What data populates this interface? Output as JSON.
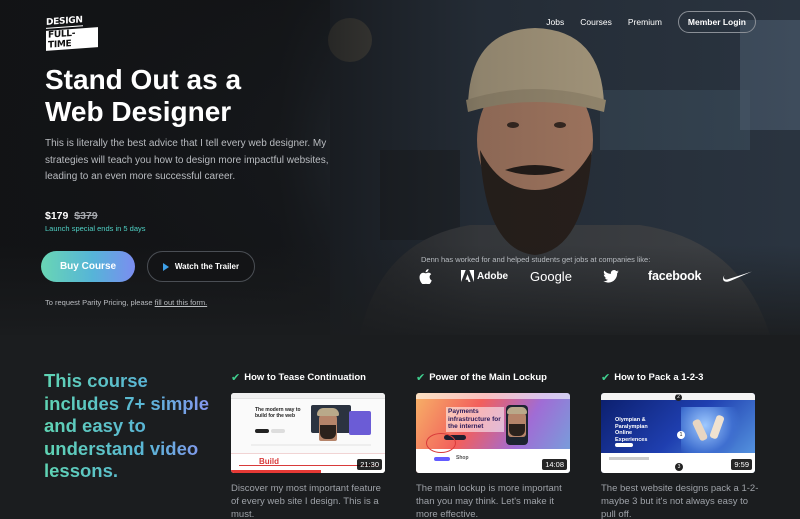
{
  "brand": {
    "logo_line1": "DESIGN",
    "logo_line2": "FULL-TIME"
  },
  "nav": {
    "jobs": "Jobs",
    "courses": "Courses",
    "premium": "Premium",
    "login": "Member Login"
  },
  "hero": {
    "title": "Stand Out as a Web Designer",
    "lead": "This is literally the best advice that I tell every web designer. My strategies will teach you how to design more impactful websites, leading to an even more successful career.",
    "price": "$179",
    "old_price": "$379",
    "special": "Launch special ends in 5 days",
    "buy_label": "Buy Course",
    "trailer_label": "Watch the Trailer",
    "parity_prefix": "To request Parity Pricing, please ",
    "parity_link": "fill out this form."
  },
  "companies": {
    "intro": "Denn has worked for and helped students get jobs at companies like:",
    "logos": [
      "apple-icon",
      "Adobe",
      "Google",
      "twitter-icon",
      "facebook",
      "nike-icon"
    ]
  },
  "course_intro": "This course includes 7+ simple and easy to understand video lessons.",
  "lessons": [
    {
      "title": "How to Tease Continuation",
      "duration": "21:30",
      "description": "Discover my most important feature of every web site I design. This is a must.",
      "thumb_heading": "The modern way to build for the web",
      "thumb_word": "Build"
    },
    {
      "title": "Power of the Main Lockup",
      "duration": "14:08",
      "description": "The main lockup is more important than you may think. Let's make it more effective.",
      "thumb_heading": "Payments infrastructure for the internet",
      "thumb_word": "Shop"
    },
    {
      "title": "How to Pack a 1-2-3",
      "duration": "9:59",
      "description": "The best website designs pack a 1-2-maybe 3 but it's not always easy to pull off.",
      "thumb_heading": "Olympian & Paralympian Online Experiences",
      "thumb_word": "2"
    }
  ],
  "colors": {
    "accent_green": "#3fcf8e",
    "accent_teal": "#4fd1c5",
    "play_blue": "#3ea0e8"
  }
}
